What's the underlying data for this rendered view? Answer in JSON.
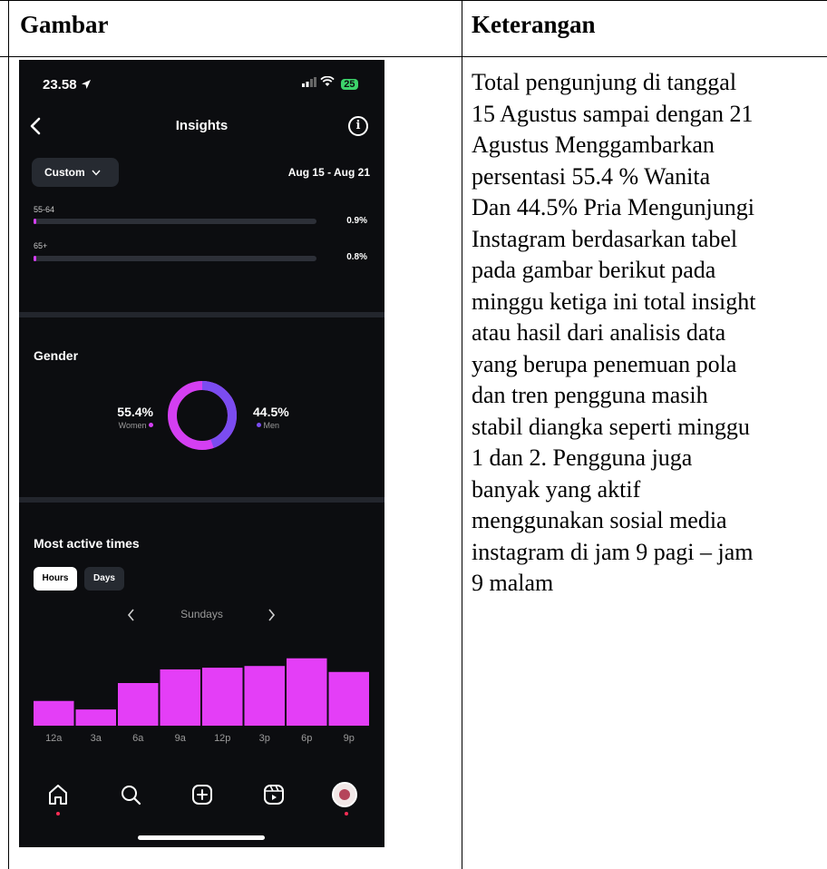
{
  "table": {
    "col1_header": "Gambar",
    "col2_header": "Keterangan",
    "description": "Total pengunjung di tanggal\n15 Agustus sampai dengan 21\nAgustus Menggambarkan\npersentasi 55.4 % Wanita\nDan 44.5% Pria Mengunjungi\nInstagram  berdasarkan tabel\npada gambar berikut pada\nminggu ketiga ini total insight\natau hasil dari analisis data\nyang berupa penemuan pola\ndan tren pengguna masih\nstabil diangka seperti minggu\n1 dan 2. Pengguna juga\nbanyak yang aktif\nmenggunakan sosial media\ninstagram di jam 9 pagi – jam\n9 malam"
  },
  "phone": {
    "status": {
      "time": "23.58",
      "battery": "25"
    },
    "nav": {
      "title": "Insights",
      "info": "i"
    },
    "filter": {
      "label": "Custom",
      "date_range": "Aug 15 - Aug 21"
    },
    "age_groups": [
      {
        "label": "55-64",
        "percent": "0.9%"
      },
      {
        "label": "65+",
        "percent": "0.8%"
      }
    ],
    "gender": {
      "title": "Gender",
      "women_pct": "55.4%",
      "women_label": "Women",
      "men_pct": "44.5%",
      "men_label": "Men",
      "women_value": 55.4,
      "men_value": 44.5
    },
    "active_times": {
      "title": "Most active times",
      "tab_hours": "Hours",
      "tab_days": "Days",
      "day": "Sundays"
    },
    "colors": {
      "women": "#d43ff2",
      "men": "#7b4cf0",
      "bar": "#e43ef7"
    }
  },
  "chart_data": {
    "type": "bar",
    "categories": [
      "12a",
      "3a",
      "6a",
      "9a",
      "12p",
      "3p",
      "6p",
      "9p"
    ],
    "values": [
      29,
      19,
      50,
      66,
      68,
      70,
      79,
      63
    ],
    "xlabel": "",
    "ylabel": "",
    "ylim": [
      0,
      100
    ]
  }
}
